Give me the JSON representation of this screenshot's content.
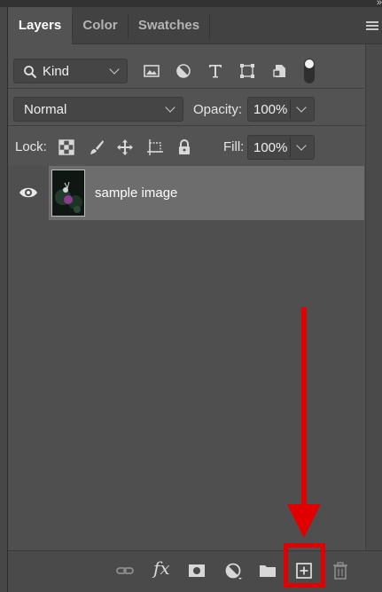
{
  "panel": {
    "tabs": [
      "Layers",
      "Color",
      "Swatches"
    ],
    "collapse_glyph": "»",
    "filter": {
      "kind_label": "Kind",
      "icons": [
        "image-filter-icon",
        "adjustment-filter-icon",
        "type-filter-icon",
        "shape-filter-icon",
        "smart-object-filter-icon"
      ]
    },
    "blend_mode": "Normal",
    "opacity_label": "Opacity:",
    "opacity_value": "100%",
    "lock_label": "Lock:",
    "fill_label": "Fill:",
    "fill_value": "100%"
  },
  "layers": [
    {
      "name": "sample image",
      "visible": true
    }
  ],
  "footer": {
    "fx_label": "fx",
    "icons": [
      "link-layers-icon",
      "layer-style-icon",
      "layer-mask-icon",
      "adjustment-layer-icon",
      "new-group-icon",
      "new-layer-icon",
      "delete-layer-icon"
    ]
  },
  "colors": {
    "panel_bg": "#535353",
    "selected_layer": "#6d6d6d",
    "highlight": "#e00000",
    "arrow": "#e00000"
  }
}
